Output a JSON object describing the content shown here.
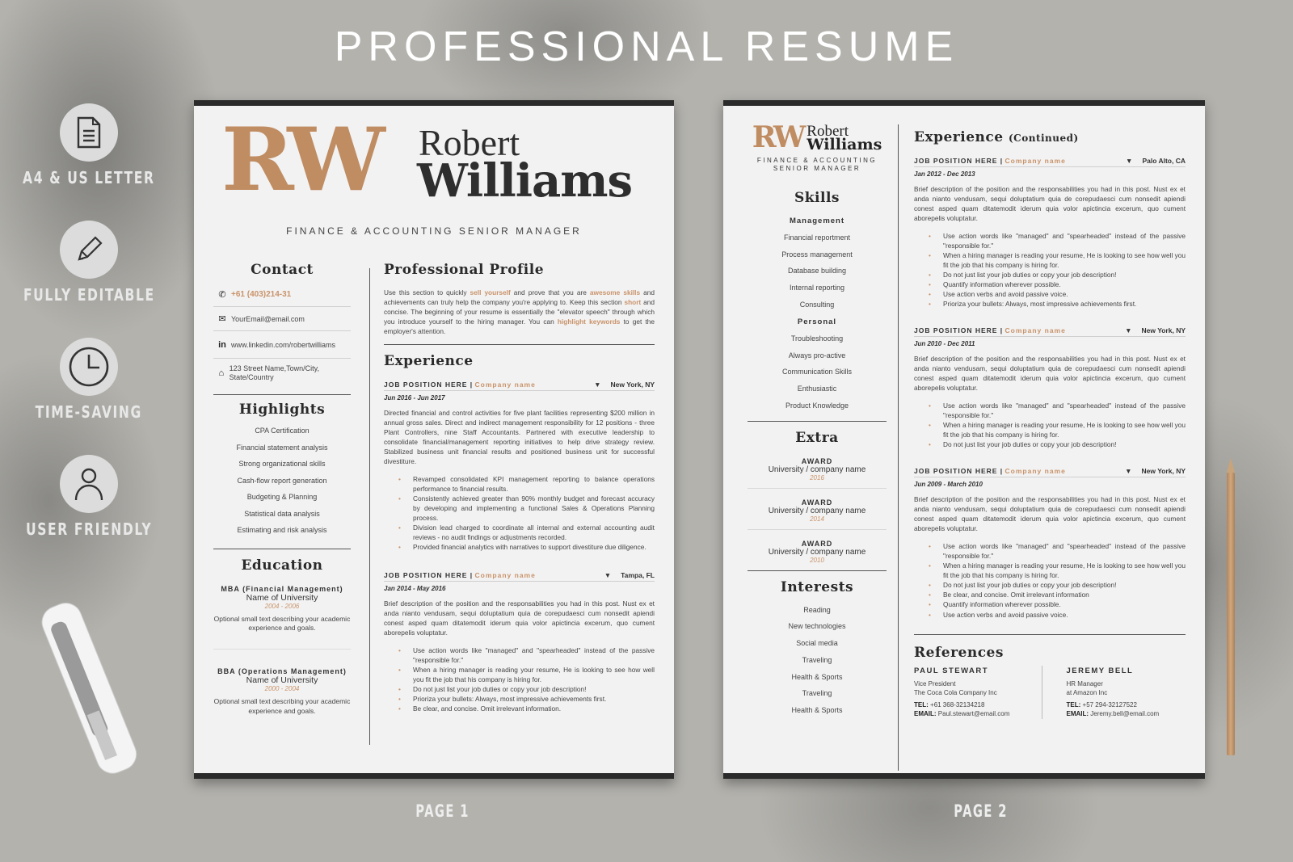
{
  "title": "PROFESSIONAL RESUME",
  "features": [
    {
      "icon": "document-icon",
      "label": "A4 & US LETTER"
    },
    {
      "icon": "pencil-icon",
      "label": "FULLY EDITABLE"
    },
    {
      "icon": "clock-icon",
      "label": "TIME-SAVING"
    },
    {
      "icon": "user-icon",
      "label": "USER FRIENDLY"
    }
  ],
  "page_labels": [
    "PAGE 1",
    "PAGE 2"
  ],
  "accent_color": "#c9936a",
  "resume": {
    "monogram": "RW",
    "first_name": "Robert",
    "last_name": "Williams",
    "subtitle": "FINANCE & ACCOUNTING SENIOR MANAGER",
    "subtitle_line1": "FINANCE & ACCOUNTING",
    "subtitle_line2": "SENIOR MANAGER",
    "contact": {
      "heading": "Contact",
      "phone": "+61 (403)214-31",
      "email": "YourEmail@email.com",
      "linkedin": "www.linkedin.com/robertwilliams",
      "address": "123 Street Name,Town/City, State/Country"
    },
    "highlights": {
      "heading": "Highlights",
      "items": [
        "CPA Certification",
        "Financial statement analysis",
        "Strong organizational skills",
        "Cash-flow report generation",
        "Budgeting & Planning",
        "Statistical data analysis",
        "Estimating and risk analysis"
      ]
    },
    "education": {
      "heading": "Education",
      "items": [
        {
          "degree": "MBA (Financial Management)",
          "school": "Name of University",
          "years": "2004 - 2006",
          "desc": "Optional small text describing your academic experience and goals."
        },
        {
          "degree": "BBA (Operations Management)",
          "school": "Name of University",
          "years": "2000 - 2004",
          "desc": "Optional small text describing your academic experience and goals."
        }
      ]
    },
    "profile": {
      "heading": "Professional Profile",
      "parts": [
        {
          "t": "Use this section to quickly ",
          "h": false
        },
        {
          "t": "sell yourself",
          "h": true
        },
        {
          "t": " and prove that you are ",
          "h": false
        },
        {
          "t": "awesome skills",
          "h": true
        },
        {
          "t": " and achievements can truly help the company you're applying to. Keep this section ",
          "h": false
        },
        {
          "t": "short",
          "h": true
        },
        {
          "t": " and concise. The beginning of your resume is essentially the \"elevator speech\" through which you introduce yourself to the hiring manager. You can ",
          "h": false
        },
        {
          "t": "highlight keywords",
          "h": true
        },
        {
          "t": " to get the employer's attention.",
          "h": false
        }
      ]
    },
    "experience": {
      "heading": "Experience",
      "heading_cont": "Experience",
      "cont_suffix": "(Continued)",
      "jobs": [
        {
          "position": "JOB POSITION HERE |",
          "company": "Company name",
          "location": "New York, NY",
          "dates": "Jun 2016 - Jun 2017",
          "desc": "Directed financial and control activities for five plant facilities representing $200 million in annual gross sales. Direct and indirect management responsibility for 12 positions - three Plant Controllers, nine Staff Accountants. Partnered with executive leadership to consolidate financial/management reporting initiatives to help drive strategy review. Stabilized business unit financial results and positioned business unit for successful divestiture.",
          "bullets": [
            "Revamped consolidated KPI management reporting to balance operations performance to financial results.",
            "Consistently achieved greater than 90% monthly budget and forecast accuracy by developing and implementing a functional Sales & Operations Planning process.",
            "Division lead charged to coordinate all internal and external accounting audit reviews - no audit findings or adjustments recorded.",
            "Provided financial analytics with narratives to support divestiture due diligence."
          ]
        },
        {
          "position": "JOB POSITION HERE |",
          "company": "Company name",
          "location": "Tampa, FL",
          "dates": "Jan 2014 - May 2016",
          "desc": "Brief description of the position and the responsabilities you had in this post. Nust ex et anda nianto vendusam, sequi doluptatium quia de corepudaesci cum nonsedit apiendi conest asped quam ditatemodit iderum quia volor apictincia excerum, quo cument aborepelis voluptatur.",
          "bullets": [
            "Use action words like \"managed\" and \"spearheaded\" instead of the passive \"responsible for.\"",
            "When a hiring manager is reading your resume, He is looking to see how well you fit the job that his company is hiring for.",
            "Do not just list your job duties or copy your job description!",
            "Prioriza your bullets: Always, most impressive achievements first.",
            "Be clear, and concise. Omit irrelevant information."
          ]
        },
        {
          "position": "JOB POSITION HERE |",
          "company": "Company name",
          "location": "Palo Alto, CA",
          "dates": "Jan 2012 - Dec 2013",
          "desc": "Brief description of the position and the responsabilities you had in this post. Nust ex et anda nianto vendusam, sequi doluptatium quia de corepudaesci cum nonsedit apiendi conest asped quam ditatemodit iderum quia volor apictincia excerum, quo cument aborepelis voluptatur.",
          "bullets": [
            "Use action words like \"managed\" and \"spearheaded\" instead of the passive \"responsible for.\"",
            "When a hiring manager is reading your resume, He is looking to see how well you fit the job that his company is hiring for.",
            "Do not just list your job duties or copy your job description!",
            "Quantify information wherever possible.",
            "Use action verbs and avoid passive voice.",
            "Prioriza your bullets: Always, most impressive achievements first."
          ]
        },
        {
          "position": "JOB POSITION HERE |",
          "company": "Company name",
          "location": "New York, NY",
          "dates": "Jun 2010 - Dec 2011",
          "desc": "Brief description of the position and the responsabilities you had in this post. Nust ex et anda nianto vendusam, sequi doluptatium quia de corepudaesci cum nonsedit apiendi conest asped quam ditatemodit iderum quia volor apictincia excerum, quo cument aborepelis voluptatur.",
          "bullets": [
            "Use action words like \"managed\" and \"spearheaded\" instead of the passive \"responsible for.\"",
            "When a hiring manager is reading your resume, He is looking to see how well you fit the job that his company is hiring for.",
            "Do not just list your job duties or copy your job description!"
          ]
        },
        {
          "position": "JOB POSITION HERE |",
          "company": "Company name",
          "location": "New York, NY",
          "dates": "Jun 2009 - March 2010",
          "desc": "Brief description of the position and the responsabilities you had in this post. Nust ex et anda nianto vendusam, sequi doluptatium quia de corepudaesci cum nonsedit apiendi conest asped quam ditatemodit iderum quia volor apictincia excerum, quo cument aborepelis voluptatur.",
          "bullets": [
            "Use action words like \"managed\" and \"spearheaded\" instead of the passive \"responsible for.\"",
            "When a hiring manager is reading your resume, He is looking to see how well you fit the job that his company is hiring for.",
            "Do not just list your job duties or copy your job description!",
            "Be clear, and concise. Omit irrelevant information",
            "Quantify information wherever possible.",
            "Use action verbs and avoid passive voice."
          ]
        }
      ]
    },
    "skills": {
      "heading": "Skills",
      "management_label": "Management",
      "management": [
        "Financial reportment",
        "Process management",
        "Database building",
        "Internal reporting",
        "Consulting"
      ],
      "personal_label": "Personal",
      "personal": [
        "Troubleshooting",
        "Always pro-active",
        "Communication Skills",
        "Enthusiastic",
        "Product Knowledge"
      ]
    },
    "extra": {
      "heading": "Extra",
      "awards": [
        {
          "title": "AWARD",
          "org": "University / company name",
          "year": "2016"
        },
        {
          "title": "AWARD",
          "org": "University / company name",
          "year": "2014"
        },
        {
          "title": "AWARD",
          "org": "University / company name",
          "year": "2010"
        }
      ]
    },
    "interests": {
      "heading": "Interests",
      "items": [
        "Reading",
        "New technologies",
        "Social media",
        "Traveling",
        "Health & Sports",
        "Traveling",
        "Health & Sports"
      ]
    },
    "references": {
      "heading": "References",
      "tel_label": "TEL:",
      "email_label": "EMAIL:",
      "items": [
        {
          "name": "PAUL STEWART",
          "role": "Vice President",
          "company": "The Coca Cola Company Inc",
          "tel": "+61 368-32134218",
          "email": "Paul.stewart@email.com"
        },
        {
          "name": "JEREMY BELL",
          "role": "HR Manager",
          "company": "at Amazon Inc",
          "tel": "+57 294-32127522",
          "email": "Jeremy.bell@email.com"
        }
      ]
    }
  }
}
